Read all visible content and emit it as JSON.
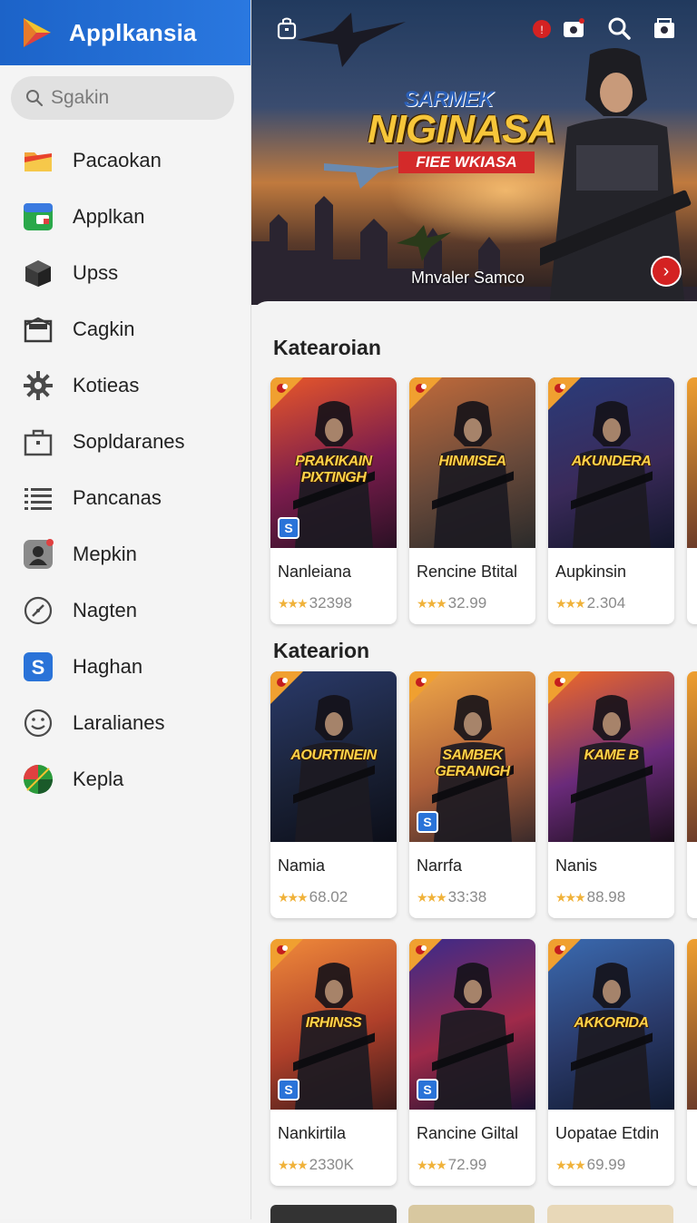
{
  "app": {
    "title": "Applkansia",
    "search_placeholder": "Sgakin"
  },
  "sidebar": {
    "items": [
      {
        "label": "Pacaokan",
        "icon": "folder-icon"
      },
      {
        "label": "Applkan",
        "icon": "apps-icon"
      },
      {
        "label": "Upss",
        "icon": "cube-icon"
      },
      {
        "label": "Cagkin",
        "icon": "envelope-icon"
      },
      {
        "label": "Kotieas",
        "icon": "gear-icon"
      },
      {
        "label": "Sopldaranes",
        "icon": "briefcase-icon"
      },
      {
        "label": "Pancanas",
        "icon": "list-icon"
      },
      {
        "label": "Mepkin",
        "icon": "avatar-icon"
      },
      {
        "label": "Nagten",
        "icon": "compass-icon"
      },
      {
        "label": "Haghan",
        "icon": "s-app-icon"
      },
      {
        "label": "Laralianes",
        "icon": "smile-icon"
      },
      {
        "label": "Kepla",
        "icon": "leaf-icon"
      }
    ]
  },
  "hero": {
    "logo_sub": "SARMEK",
    "logo_main": "NIGINASA",
    "logo_ribbon": "FIEE WKIASA",
    "caption": "Mnvaler Samco",
    "next_symbol": "›"
  },
  "sections": [
    {
      "title": "Katearoian",
      "cards": [
        {
          "name": "Nanleiana",
          "rating": "32398",
          "art_title": "PRAKIKAIN PIXTINGH",
          "colors": [
            "#e8572a",
            "#7a1c4c",
            "#2a1024"
          ],
          "badge": "S"
        },
        {
          "name": "Rencine Btital",
          "rating": "32.99",
          "art_title": "HINMISEA",
          "colors": [
            "#c06a3a",
            "#6a4a3a",
            "#2a2a2a"
          ],
          "badge": ""
        },
        {
          "name": "Aupkinsin",
          "rating": "2.304",
          "art_title": "AKUNDERA",
          "colors": [
            "#2a3c7a",
            "#3a2a5a",
            "#12162a"
          ],
          "badge": ""
        }
      ]
    },
    {
      "title": "Katearion",
      "cards": [
        {
          "name": "Namia",
          "rating": "68.02",
          "art_title": "AOURTINEIN",
          "colors": [
            "#2a3a6a",
            "#1a2238",
            "#0c0e18"
          ],
          "badge": ""
        },
        {
          "name": "Narrfa",
          "rating": "33:38",
          "art_title": "SAMBEK GERANIGH",
          "colors": [
            "#f0a848",
            "#b0603a",
            "#3a2a2a"
          ],
          "badge": "S"
        },
        {
          "name": "Nanis",
          "rating": "88.98",
          "art_title": "KAME B",
          "colors": [
            "#f06a28",
            "#6a2a7a",
            "#1a0e1a"
          ],
          "badge": ""
        }
      ]
    },
    {
      "title": "",
      "cards": [
        {
          "name": "Nankirtila",
          "rating": "2330K",
          "art_title": "IRHINSS",
          "colors": [
            "#f08a3a",
            "#b0402a",
            "#3a1a1a"
          ],
          "badge": "S"
        },
        {
          "name": "Rancine Giltal",
          "rating": "72.99",
          "art_title": "",
          "colors": [
            "#3a2a8a",
            "#a02a4a",
            "#1a1030"
          ],
          "badge": "S"
        },
        {
          "name": "Uopatae Etdin",
          "rating": "69.99",
          "art_title": "AKKORIDA",
          "colors": [
            "#3a6ab0",
            "#2a3a6a",
            "#101a30"
          ],
          "badge": ""
        }
      ]
    }
  ]
}
